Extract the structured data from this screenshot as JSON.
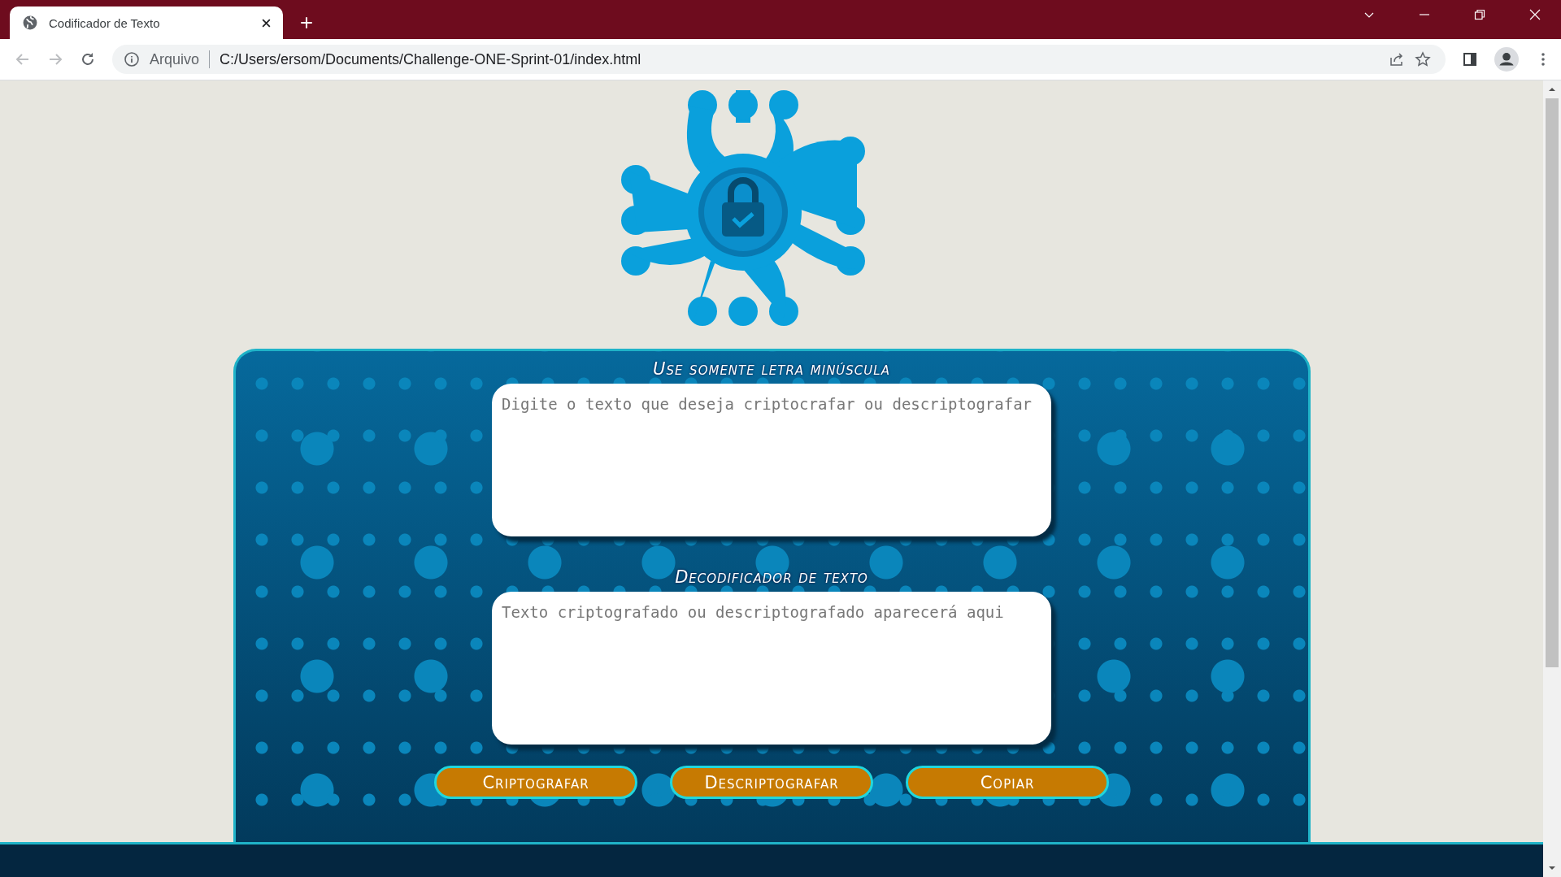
{
  "browser": {
    "tab": {
      "title": "Codificador de Texto",
      "selected": true
    },
    "address": {
      "security_label": "Arquivo",
      "url": "C:/Users/ersom/Documents/Challenge-ONE-Sprint-01/index.html"
    }
  },
  "page": {
    "input_label": "Use somente letra minúscula",
    "input": {
      "placeholder": "Digite o texto que deseja criptocrafar ou descriptografar"
    },
    "output_label": "Decodificador de texto",
    "output": {
      "placeholder": "Texto criptografado ou descriptografado aparecerá aqui"
    },
    "buttons": [
      "Criptografar",
      "Descriptografar",
      "Copiar"
    ]
  }
}
